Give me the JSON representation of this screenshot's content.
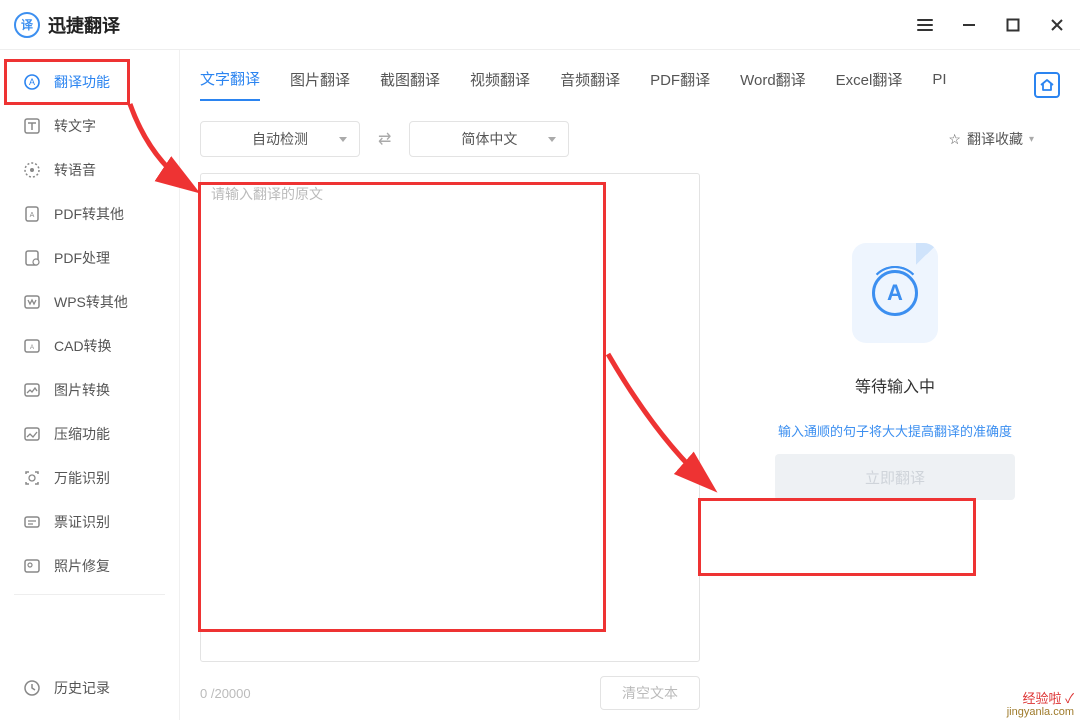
{
  "titlebar": {
    "app_name": "迅捷翻译",
    "logo_letter": "译"
  },
  "sidebar": {
    "items": [
      {
        "label": "翻译功能"
      },
      {
        "label": "转文字"
      },
      {
        "label": "转语音"
      },
      {
        "label": "PDF转其他"
      },
      {
        "label": "PDF处理"
      },
      {
        "label": "WPS转其他"
      },
      {
        "label": "CAD转换"
      },
      {
        "label": "图片转换"
      },
      {
        "label": "压缩功能"
      },
      {
        "label": "万能识别"
      },
      {
        "label": "票证识别"
      },
      {
        "label": "照片修复"
      }
    ],
    "history": "历史记录"
  },
  "tabs": {
    "items": [
      {
        "label": "文字翻译"
      },
      {
        "label": "图片翻译"
      },
      {
        "label": "截图翻译"
      },
      {
        "label": "视频翻译"
      },
      {
        "label": "音频翻译"
      },
      {
        "label": "PDF翻译"
      },
      {
        "label": "Word翻译"
      },
      {
        "label": "Excel翻译"
      },
      {
        "label": "PI"
      }
    ]
  },
  "langbar": {
    "source": "自动检测",
    "target": "简体中文",
    "fav": "翻译收藏"
  },
  "editor": {
    "placeholder": "请输入翻译的原文",
    "count": "0",
    "max": "/20000",
    "clear": "清空文本"
  },
  "right": {
    "icon_letter": "A",
    "waiting": "等待输入中",
    "hint": "输入通顺的句子将大大提高翻译的准确度",
    "go": "立即翻译"
  },
  "watermark": {
    "line1": "经验啦 ✓",
    "line2": "jingyanla.com"
  }
}
